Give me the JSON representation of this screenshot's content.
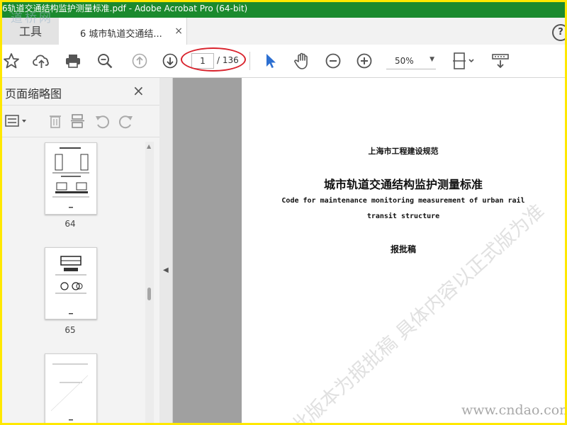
{
  "window": {
    "title": "6轨道交通结构监护测量标准.pdf - Adobe Acrobat Pro (64-bit)",
    "watermark_logo": "道桥网"
  },
  "tabs": {
    "tools_label": "工具",
    "doc_tab_label": "6 城市轨道交通结...",
    "close_glyph": "×",
    "help_glyph": "?"
  },
  "toolbar": {
    "current_page": "1",
    "total_pages": "/ 136",
    "zoom_value": "50%",
    "icons": [
      "star-icon",
      "cloud-upload-icon",
      "print-icon",
      "zoom-search-icon",
      "page-up-icon",
      "page-down-icon",
      "select-cursor-icon",
      "hand-icon",
      "zoom-out-icon",
      "zoom-in-icon",
      "fit-page-icon",
      "scroll-mode-icon"
    ]
  },
  "left_panel": {
    "title": "页面缩略图",
    "close_glyph": "×",
    "thumbnails": [
      {
        "page": "64"
      },
      {
        "page": "65"
      },
      {
        "page": ""
      }
    ]
  },
  "document": {
    "line1": "上海市工程建设规范",
    "line2": "城市轨道交通结构监护测量标准",
    "line3": "Code for maintenance monitoring measurement of urban rail",
    "line4": "transit structure",
    "line5": "报批稿",
    "watermark": "此版本为报批稿 具体内容以正式版为准",
    "site_mark": "www.cndao.com"
  },
  "colors": {
    "title_bar": "#1b8a2e",
    "border": "#ffe800",
    "annotation_ring": "#d9232d"
  }
}
